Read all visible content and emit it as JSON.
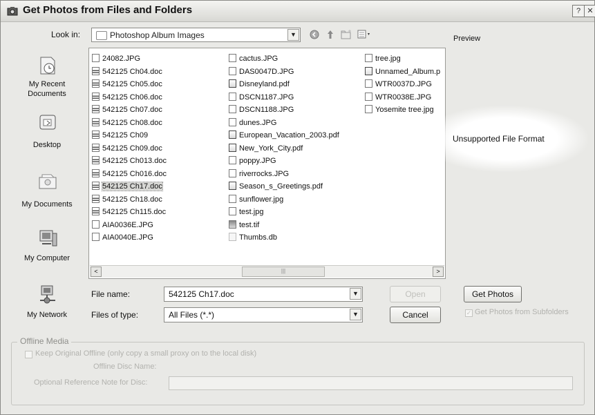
{
  "title": "Get Photos from Files and Folders",
  "title_buttons": [
    "?",
    "✕"
  ],
  "look_in": {
    "label": "Look in:",
    "value": "Photoshop Album Images"
  },
  "toolbar": {
    "back_icon": "back-icon",
    "up_icon": "up-folder-icon",
    "new_folder_icon": "new-folder-icon",
    "view_menu_icon": "view-menu-icon"
  },
  "places": [
    {
      "label": "My Recent Documents",
      "icon": "recent-documents-icon"
    },
    {
      "label": "Desktop",
      "icon": "desktop-icon"
    },
    {
      "label": "My Documents",
      "icon": "my-documents-icon"
    },
    {
      "label": "My Computer",
      "icon": "my-computer-icon"
    },
    {
      "label": "My Network",
      "icon": "my-network-icon"
    }
  ],
  "files": {
    "col1": [
      {
        "name": "24082.JPG",
        "type": "jpg"
      },
      {
        "name": "542125 Ch04.doc",
        "type": "doc"
      },
      {
        "name": "542125 Ch05.doc",
        "type": "doc"
      },
      {
        "name": "542125 Ch06.doc",
        "type": "doc"
      },
      {
        "name": "542125 Ch07.doc",
        "type": "doc"
      },
      {
        "name": "542125 Ch08.doc",
        "type": "doc"
      },
      {
        "name": "542125 Ch09",
        "type": "doc"
      },
      {
        "name": "542125 Ch09.doc",
        "type": "doc"
      },
      {
        "name": "542125 Ch013.doc",
        "type": "doc"
      },
      {
        "name": "542125 Ch016.doc",
        "type": "doc"
      },
      {
        "name": "542125 Ch17.doc",
        "type": "doc",
        "selected": true
      },
      {
        "name": "542125 Ch18.doc",
        "type": "doc"
      },
      {
        "name": "542125 Ch115.doc",
        "type": "doc"
      },
      {
        "name": "AIA0036E.JPG",
        "type": "jpg"
      },
      {
        "name": "AIA0040E.JPG",
        "type": "jpg"
      }
    ],
    "col2": [
      {
        "name": "cactus.JPG",
        "type": "jpg"
      },
      {
        "name": "DAS0047D.JPG",
        "type": "jpg"
      },
      {
        "name": "Disneyland.pdf",
        "type": "pdf"
      },
      {
        "name": "DSCN1187.JPG",
        "type": "jpg"
      },
      {
        "name": "DSCN1188.JPG",
        "type": "jpg"
      },
      {
        "name": "dunes.JPG",
        "type": "jpg"
      },
      {
        "name": "European_Vacation_2003.pdf",
        "type": "pdf"
      },
      {
        "name": "New_York_City.pdf",
        "type": "pdf"
      },
      {
        "name": "poppy.JPG",
        "type": "jpg"
      },
      {
        "name": "riverrocks.JPG",
        "type": "jpg"
      },
      {
        "name": "Season_s_Greetings.pdf",
        "type": "pdf"
      },
      {
        "name": "sunflower.jpg",
        "type": "jpg"
      },
      {
        "name": "test.jpg",
        "type": "jpg"
      },
      {
        "name": "test.tif",
        "type": "tif"
      },
      {
        "name": "Thumbs.db",
        "type": "db"
      }
    ],
    "col3": [
      {
        "name": "tree.jpg",
        "type": "jpg"
      },
      {
        "name": "Unnamed_Album.p",
        "type": "pdf"
      },
      {
        "name": "WTR0037D.JPG",
        "type": "jpg"
      },
      {
        "name": "WTR0038E.JPG",
        "type": "jpg"
      },
      {
        "name": "Yosemite tree.jpg",
        "type": "jpg"
      }
    ]
  },
  "file_name": {
    "label": "File name:",
    "value": "542125 Ch17.doc"
  },
  "file_type": {
    "label": "Files of type:",
    "value": "All Files (*.*)"
  },
  "buttons": {
    "open": "Open",
    "cancel": "Cancel",
    "get_photos": "Get Photos"
  },
  "preview": {
    "label": "Preview",
    "message": "Unsupported File Format"
  },
  "subfolders": {
    "label": "Get Photos from Subfolders",
    "checked": true,
    "enabled": false
  },
  "offline": {
    "group_title": "Offline Media",
    "keep_original": "Keep Original Offline (only copy a small proxy on to the local disk)",
    "disc_name_label": "Offline Disc Name:",
    "note_label": "Optional Reference Note for Disc:",
    "note_value": ""
  },
  "scroll": {
    "left_arrow": "<",
    "right_arrow": ">",
    "thumb_grip": "|||"
  }
}
